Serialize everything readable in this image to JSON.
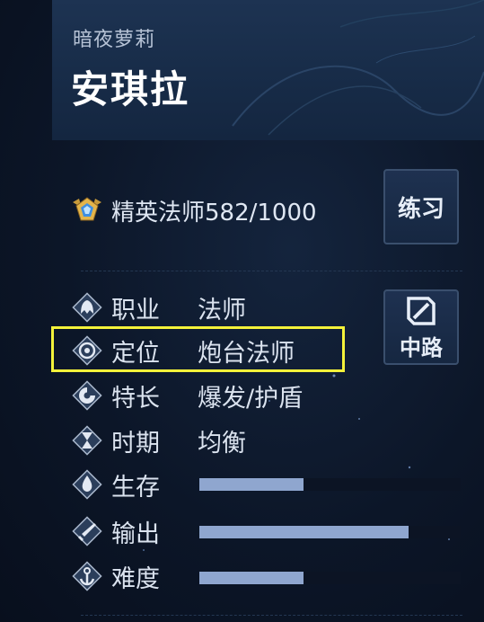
{
  "hero": {
    "subtitle": "暗夜萝莉",
    "name": "安琪拉"
  },
  "rank": {
    "text": "精英法师582/1000",
    "badge_icon": "elite-rank-badge-icon"
  },
  "buttons": {
    "practice_label": "练习",
    "lane_label": "中路",
    "lane_icon": "mid-lane-icon"
  },
  "attributes": [
    {
      "key": "职业",
      "value": "法师",
      "icon": "class-icon"
    },
    {
      "key": "定位",
      "value": "炮台法师",
      "icon": "position-target-icon"
    },
    {
      "key": "特长",
      "value": "爆发/护盾",
      "icon": "specialty-icon"
    },
    {
      "key": "时期",
      "value": "均衡",
      "icon": "hourglass-icon"
    }
  ],
  "stats": [
    {
      "key": "生存",
      "value": 0.4,
      "icon": "survival-drop-icon"
    },
    {
      "key": "输出",
      "value": 0.8,
      "icon": "damage-sword-icon"
    },
    {
      "key": "难度",
      "value": 0.4,
      "icon": "difficulty-anchor-icon"
    }
  ],
  "colors": {
    "background": "#0c1628",
    "bar_fill": "#8fa6cf",
    "highlight": "#f4f23a"
  }
}
